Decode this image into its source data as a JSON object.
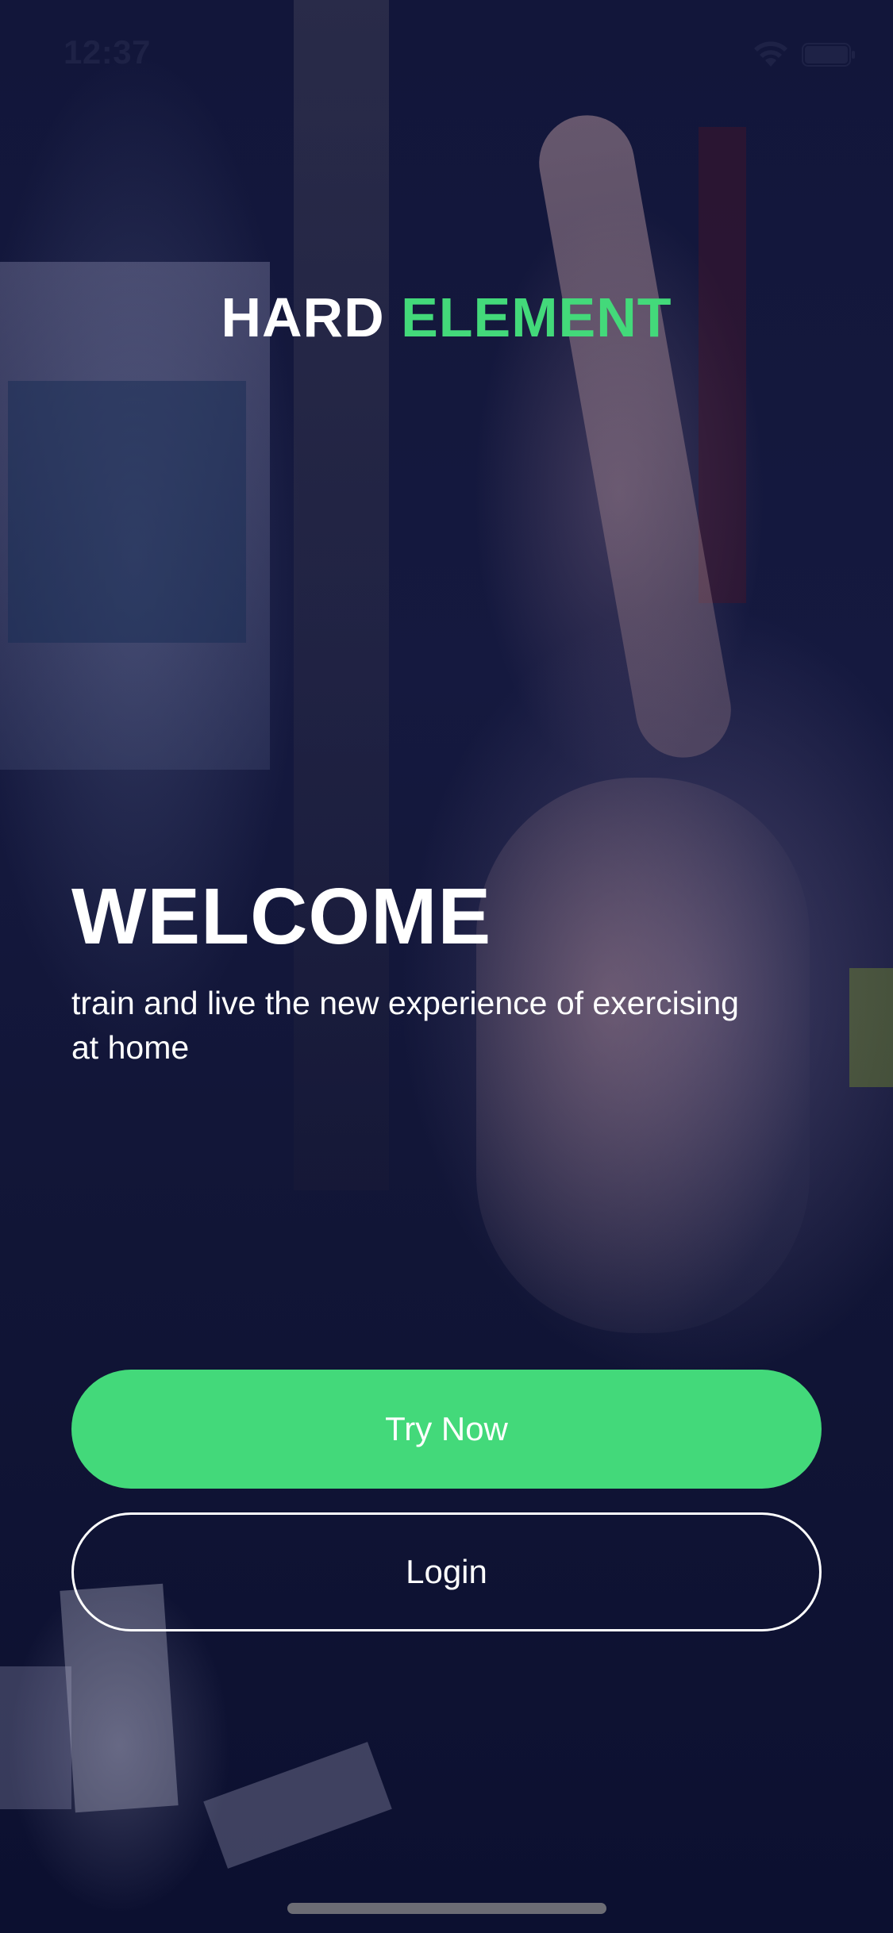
{
  "status_bar": {
    "time": "12:37",
    "wifi_icon": "wifi-icon",
    "battery_icon": "battery-icon"
  },
  "brand": {
    "part1": "HARD",
    "part2": "ELEMENT",
    "accent_color": "#43d97a"
  },
  "welcome": {
    "title": "WELCOME",
    "subtitle": "train and live the new experience of exercising at home"
  },
  "buttons": {
    "try_now": "Try Now",
    "login": "Login"
  },
  "colors": {
    "primary_button": "#43d97a",
    "text": "#ffffff",
    "overlay": "#0d1133"
  }
}
